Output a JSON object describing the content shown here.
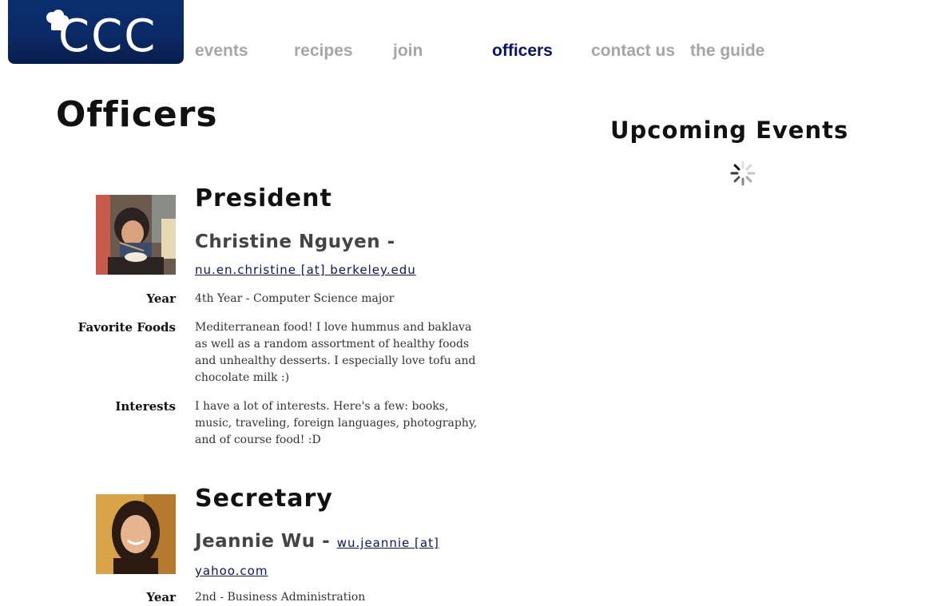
{
  "brand": {
    "logo_text": "CCC",
    "logo_color": "#0b2a66"
  },
  "nav": {
    "items": [
      {
        "label": "events",
        "active": false
      },
      {
        "label": "recipes",
        "active": false
      },
      {
        "label": "join",
        "active": false
      },
      {
        "label": "officers",
        "active": true
      },
      {
        "label": "contact us",
        "active": false
      },
      {
        "label": "the guide",
        "active": false
      }
    ]
  },
  "page": {
    "title": "Officers"
  },
  "sidebar": {
    "title": "Upcoming Events"
  },
  "officers": [
    {
      "role": "President",
      "name": "Christine Nguyen",
      "separator": " - ",
      "email": "nu.en.christine [at] berkeley.edu",
      "fields": [
        {
          "label": "Year",
          "value": "4th Year - Computer Science major"
        },
        {
          "label": "Favorite Foods",
          "value": "Mediterranean food! I love hummus and baklava as well as a random assortment of healthy foods and unhealthy desserts. I especially love tofu and chocolate milk :)"
        },
        {
          "label": "Interests",
          "value": "I have a lot of interests. Here's a few: books, music, traveling, foreign languages, photography, and of course food! :D"
        }
      ]
    },
    {
      "role": "Secretary",
      "name": "Jeannie Wu",
      "separator": " - ",
      "email": "wu.jeannie [at] yahoo.com",
      "fields": [
        {
          "label": "Year",
          "value": "2nd - Business Administration"
        }
      ]
    }
  ]
}
